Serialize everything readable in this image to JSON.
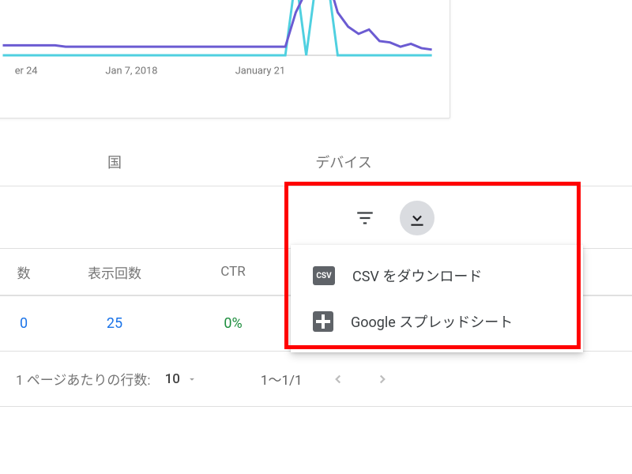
{
  "tabs": {
    "country": "国",
    "device": "デバイス"
  },
  "table": {
    "headers": {
      "clicks": "数",
      "impressions": "表示回数",
      "ctr": "CTR"
    },
    "row": {
      "clicks": "0",
      "impressions": "25",
      "ctr": "0%"
    }
  },
  "pager": {
    "rows_label": "1 ページあたりの行数:",
    "rows_value": "10",
    "range": "1～1/1"
  },
  "download_menu": {
    "csv": "CSV をダウンロード",
    "sheets": "Google スプレッドシート"
  },
  "chart_data": {
    "type": "line",
    "x_ticks": [
      "er 24",
      "Jan 7, 2018",
      "January 21"
    ],
    "ylim": [
      0,
      60
    ],
    "series": [
      {
        "name": "teal",
        "color": "#4fd0e0",
        "values": [
          0,
          0,
          0,
          0,
          0,
          0,
          0,
          0,
          0,
          0,
          0,
          0,
          0,
          0,
          0,
          0,
          0,
          0,
          0,
          0,
          0,
          0,
          0,
          0,
          0,
          0,
          0,
          0,
          55,
          0,
          55,
          55,
          0,
          0,
          0,
          0,
          0,
          0,
          0,
          0,
          0,
          0
        ]
      },
      {
        "name": "violet",
        "color": "#6b5bd2",
        "values": [
          7,
          7,
          7,
          7,
          7,
          7,
          6,
          6,
          6,
          6,
          6,
          6,
          6,
          6,
          6,
          6,
          6,
          6,
          6,
          6,
          6,
          6,
          6,
          6,
          6,
          6,
          6,
          6,
          30,
          45,
          40,
          55,
          30,
          20,
          15,
          18,
          10,
          9,
          6,
          8,
          5,
          4
        ]
      }
    ]
  }
}
